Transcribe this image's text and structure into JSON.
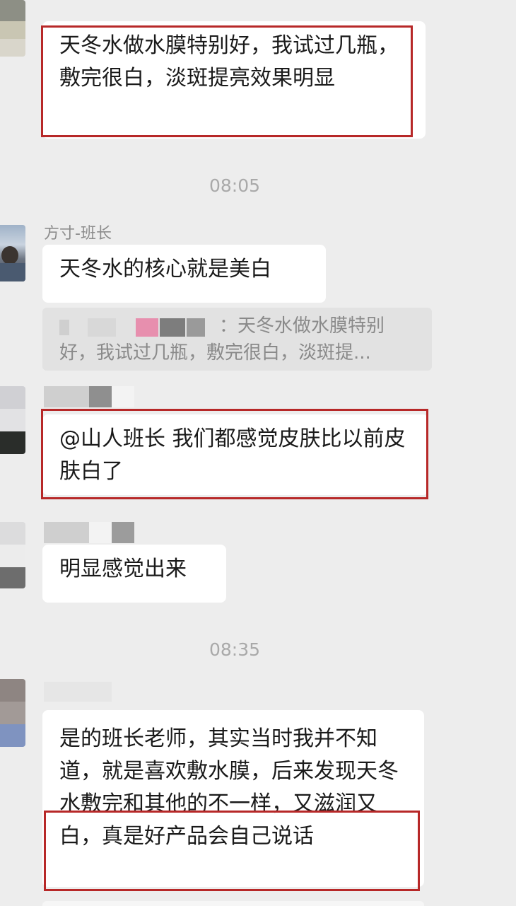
{
  "messages": {
    "msg1": {
      "text": "天冬水做水膜特别好，我试过几瓶，敷完很白，淡斑提亮效果明显"
    },
    "time1": "08:05",
    "msg2": {
      "sender": "方寸-班长",
      "text": "天冬水的核心就是美白",
      "quote_text_line1": "：天冬水做水膜特别",
      "quote_text_line2": "好，我试过几瓶，敷完很白，淡斑提..."
    },
    "msg3": {
      "text": "@山人班长 我们都感觉皮肤比以前皮肤白了"
    },
    "msg4": {
      "text": "明显感觉出来"
    },
    "time2": "08:35",
    "msg5": {
      "text": "是的班长老师，其实当时我并不知道，就是喜欢敷水膜，后来发现天冬水敷完和其他的不一样，又滋润又白，真是好产品会自己说话"
    }
  },
  "colors": {
    "background": "#ededed",
    "bubble": "#ffffff",
    "highlight_box": "#b72828",
    "quote_bg": "#e2e2e2"
  }
}
